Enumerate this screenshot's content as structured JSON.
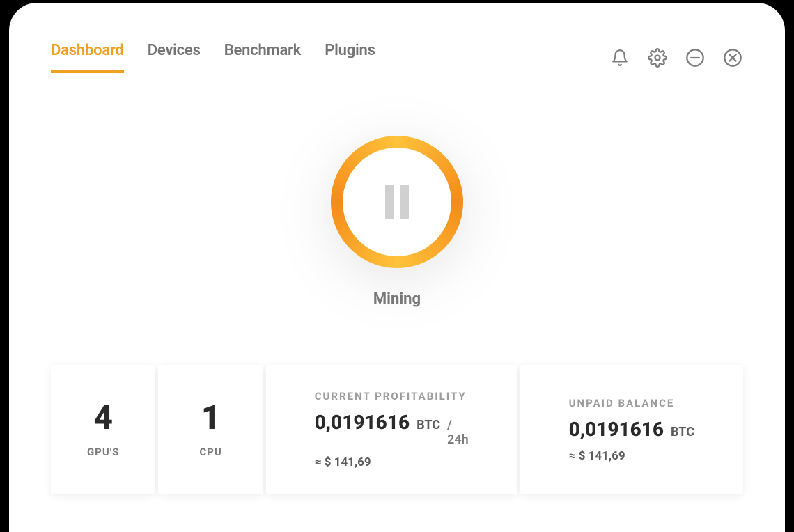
{
  "tabs": {
    "dashboard": "Dashboard",
    "devices": "Devices",
    "benchmark": "Benchmark",
    "plugins": "Plugins"
  },
  "status": {
    "label": "Mining"
  },
  "stats": {
    "gpu": {
      "value": "4",
      "label": "GPU'S"
    },
    "cpu": {
      "value": "1",
      "label": "CPU"
    },
    "profitability": {
      "title": "CURRENT PROFITABILITY",
      "amount": "0,0191616",
      "unit": "BTC",
      "per": "/ 24h",
      "approx": "≈ $ 141,69"
    },
    "balance": {
      "title": "UNPAID BALANCE",
      "amount": "0,0191616",
      "unit": "BTC",
      "approx": "≈ $ 141,69"
    }
  }
}
